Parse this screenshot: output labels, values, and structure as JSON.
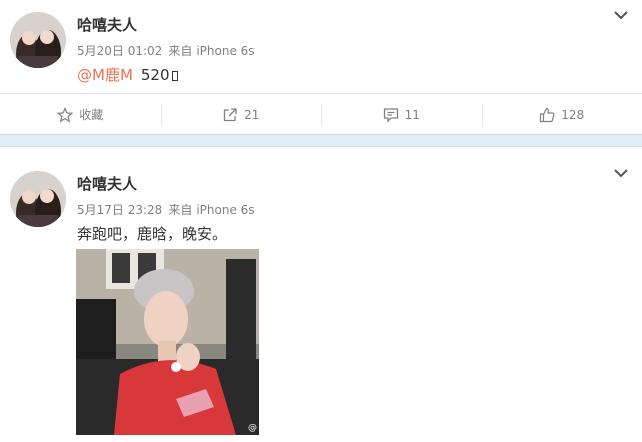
{
  "post1": {
    "author": "哈嘻夫人",
    "time": "5月20日 01:02",
    "via": "来自",
    "device": "iPhone 6s",
    "mention": "@M鹿M",
    "text": "520",
    "actions": [
      {
        "icon": "star-icon",
        "label": "收藏"
      },
      {
        "icon": "share-icon",
        "label": "21"
      },
      {
        "icon": "comment-icon",
        "label": "11"
      },
      {
        "icon": "like-icon",
        "label": "128"
      }
    ]
  },
  "post2": {
    "author": "哈嘻夫人",
    "time": "5月17日 23:28",
    "via": "来自",
    "device": "iPhone 6s",
    "text": "奔跑吧，鹿晗，晚安。",
    "image_watermark": "@"
  },
  "colors": {
    "mention": "#eb7350",
    "separator": "#e2eef7",
    "meta": "#808080"
  }
}
